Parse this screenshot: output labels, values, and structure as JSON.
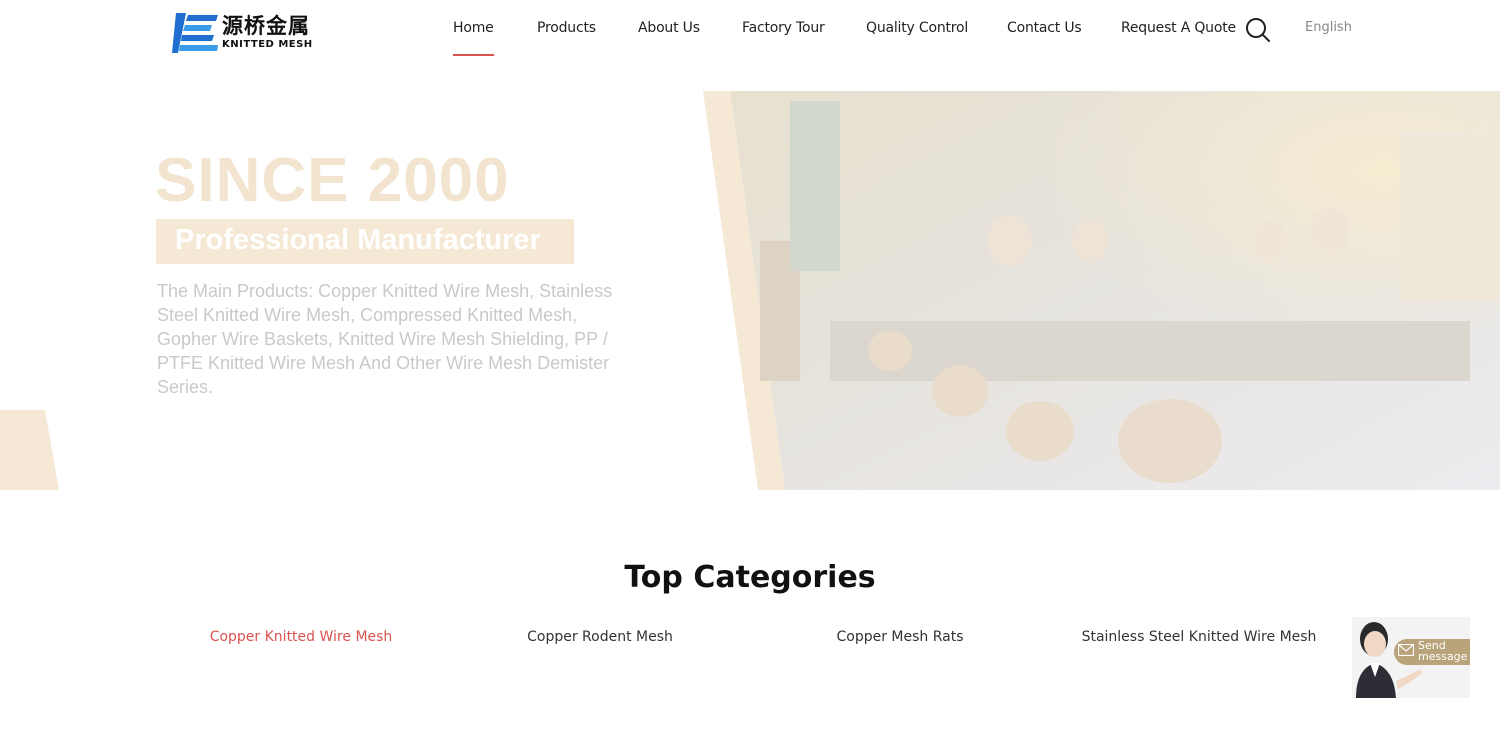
{
  "header": {
    "logo": {
      "cn": "源桥金属",
      "en": "KNITTED MESH"
    },
    "nav": [
      {
        "label": "Home",
        "active": true
      },
      {
        "label": "Products",
        "active": false
      },
      {
        "label": "About Us",
        "active": false
      },
      {
        "label": "Factory Tour",
        "active": false
      },
      {
        "label": "Quality Control",
        "active": false
      },
      {
        "label": "Contact Us",
        "active": false
      },
      {
        "label": "Request A Quote",
        "active": false
      }
    ],
    "search_icon": "search-icon",
    "language": "English"
  },
  "banner": {
    "headline": "SINCE 2000",
    "tagline": "Professional Manufacturer",
    "description": "The Main Products: Copper Knitted Wire Mesh, Stainless Steel Knitted Wire Mesh, Compressed Knitted Mesh, Gopher Wire Baskets, Knitted Wire Mesh Shielding, PP / PTFE Knitted Wire Mesh And Other Wire Mesh Demister Series."
  },
  "top_categories": {
    "title": "Top Categories",
    "items": [
      {
        "label": "Copper Knitted Wire Mesh",
        "active": true
      },
      {
        "label": "Copper Rodent Mesh",
        "active": false
      },
      {
        "label": "Copper Mesh Rats",
        "active": false
      },
      {
        "label": "Stainless Steel Knitted Wire Mesh",
        "active": false
      }
    ]
  },
  "chat_widget": {
    "label_line1": "Send",
    "label_line2": "message"
  },
  "colors": {
    "accent": "#d9534f",
    "banner_beige": "#f5e8d5",
    "logo_blue": "#1e6fd0"
  }
}
